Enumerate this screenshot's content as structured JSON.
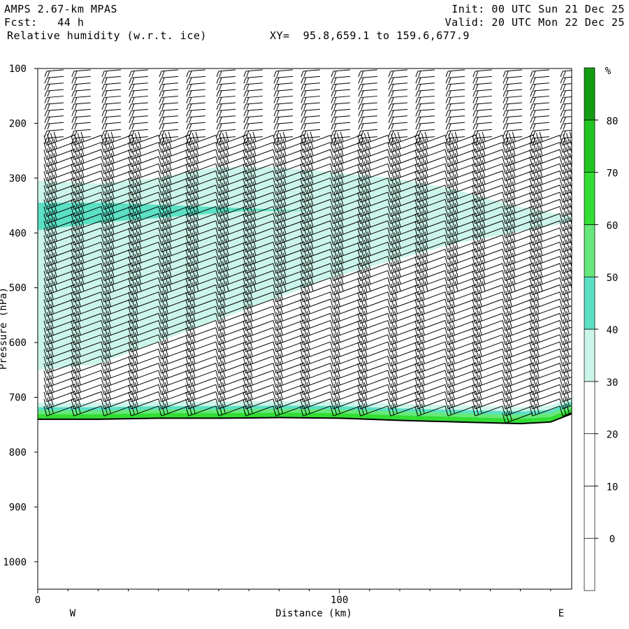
{
  "header": {
    "model": "AMPS 2.67-km MPAS",
    "forecast": "Fcst:   44 h",
    "field": "Relative humidity (w.r.t. ice)",
    "xy": "XY=  95.8,659.1 to 159.6,677.9",
    "init": "Init: 00 UTC Sun 21 Dec 25",
    "valid": "Valid: 20 UTC Mon 22 Dec 25"
  },
  "chart_data": {
    "type": "cross-section",
    "ylabel": "Pressure (hPa)",
    "xlabel": "Distance (km)",
    "ylim": [
      1050,
      100
    ],
    "y_ticks": [
      "100",
      "200",
      "300",
      "400",
      "500",
      "600",
      "700",
      "800",
      "900",
      "1000"
    ],
    "xlim": [
      0,
      177
    ],
    "x_ticks": [
      "0",
      "100"
    ],
    "x_ticks_values": [
      0,
      100
    ],
    "left_end_label": "W",
    "right_end_label": "E",
    "colorbar": {
      "unit": "%",
      "levels": [
        "0",
        "10",
        "20",
        "30",
        "40",
        "50",
        "60",
        "70",
        "80"
      ],
      "colors": [
        "#ffffff",
        "#ffffff",
        "#ffffff",
        "#ffffff",
        "#ccf5ea",
        "#5ce0c4",
        "#66e87a",
        "#33dd33",
        "#22c422",
        "#129c12"
      ]
    },
    "rh_layers": [
      {
        "name": "30-40%",
        "color": "#ccf5ea",
        "top_hpa": [
          305,
          310,
          300,
          280,
          280,
          290,
          300,
          320,
          350,
          370
        ],
        "bottom_hpa": [
          650,
          640,
          600,
          560,
          520,
          480,
          450,
          420,
          400,
          380
        ]
      },
      {
        "name": "40-50%",
        "color": "#5ce0c4",
        "top_hpa": [
          345,
          345,
          350,
          355,
          360
        ],
        "bottom_hpa": [
          395,
          380,
          370,
          360,
          360
        ]
      }
    ],
    "surface_pressure_hpa": [
      740,
      740,
      738,
      738,
      737,
      738,
      742,
      745,
      748,
      745,
      730
    ],
    "surface_x_km": [
      0,
      20,
      40,
      60,
      80,
      100,
      120,
      140,
      160,
      170,
      177
    ],
    "wind_barb_columns_km": [
      3,
      12,
      22,
      31,
      41,
      50,
      60,
      69,
      79,
      88,
      98,
      107,
      117,
      126,
      136,
      145,
      155,
      164,
      174
    ]
  }
}
